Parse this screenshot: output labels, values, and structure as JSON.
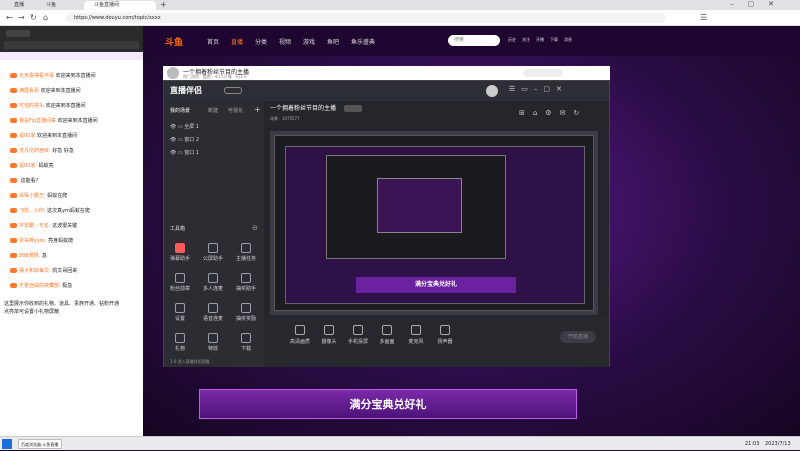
{
  "browser": {
    "tabs": [
      "直播",
      "斗鱼",
      "斗鱼直播间"
    ],
    "url": "https://www.douyu.com/topic/xxxx"
  },
  "chat": {
    "messages": [
      {
        "user": "天天看得看不挥",
        "text": "欢迎来到本直播间"
      },
      {
        "user": "满霞看看",
        "text": "欢迎来到本直播间"
      },
      {
        "user": "可怕的拼头",
        "text": "欢迎来到本直播间"
      },
      {
        "user": "我是Fig直播间来",
        "text": "欢迎来到本直播间"
      },
      {
        "user": "是00家",
        "text": "欢迎来到本直播间"
      },
      {
        "user": "洗凡伦的宿目:",
        "text": "好急 好急"
      },
      {
        "user": "是00家:",
        "text": "蚂蚁亮"
      },
      {
        "user": "",
        "text": "这能看?"
      },
      {
        "user": "采殊小霸王:",
        "text": "蚂蚁在爬"
      },
      {
        "user": "飞凯...小你:",
        "text": "这次真ym蚂蚁在爬"
      },
      {
        "user": "字雷霸 : 无名:",
        "text": "这波很关键"
      },
      {
        "user": "折哥啊yym:",
        "text": "亮身蚂蚁爬"
      },
      {
        "user": "888慢慢:",
        "text": "急"
      },
      {
        "user": "摆子和就每次:",
        "text": "凯文哥回来"
      },
      {
        "user": "乐景自由的夜藏部:",
        "text": "极急"
      }
    ],
    "notice": "这里展示你收到的礼物、道具、贵族开通、钻粉开通",
    "notice2": "点亮单可设置小礼物屏蔽"
  },
  "site": {
    "logo": "斗鱼",
    "nav": [
      "首页",
      "直播",
      "分类",
      "视频",
      "游戏",
      "鱼吧",
      "鱼乐盛典"
    ],
    "search_placeholder": "搜索",
    "user_icons": [
      "历史",
      "关注",
      "开播",
      "下载",
      "消息"
    ]
  },
  "stream": {
    "title": "一个拥着粉丝节目的主播",
    "meta": "热门游戏 · 酷跑 · 4/15开播 · 831%",
    "heat": "1975577",
    "app_title": "直播伴侣",
    "tabs": [
      "我的场景",
      "新建",
      "可视化"
    ],
    "scenes": [
      "全屏 1",
      "窗口 2",
      "窗口 1"
    ],
    "tools_title": "工具箱",
    "tools": [
      "弹幕助手",
      "公屏助手",
      "主播任务",
      "粉丝勋章",
      "多人连麦",
      "抽奖助手",
      "设置",
      "语音连麦",
      "抽奖奖励",
      "礼物",
      "特效",
      "下载"
    ],
    "bottom": [
      "高清画质",
      "摄像头",
      "手机投屏",
      "多画面",
      "麦克风",
      "扬声器"
    ],
    "start_live": "开始直播",
    "status": "1.0 进入直播伴侣观看",
    "hot_scene": "场景"
  },
  "banner": {
    "text": "满分宝典兑好礼"
  },
  "taskbar": {
    "clock": "2023/7/13",
    "time": "21:03",
    "app": "百度浏览器·斗鱼直播"
  }
}
